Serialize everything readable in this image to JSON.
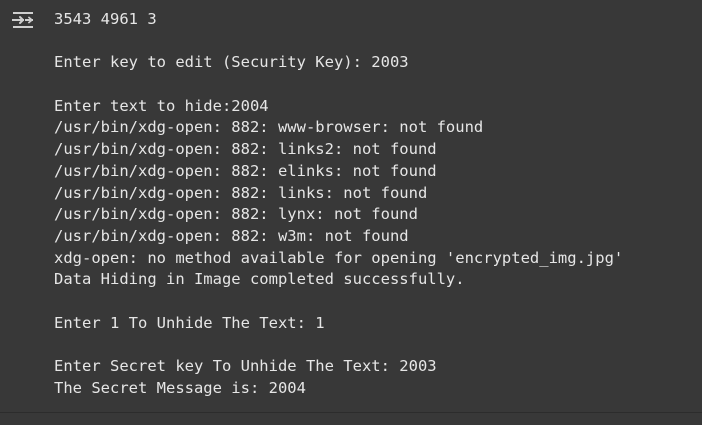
{
  "cell": {
    "toggle_icon": "output-toggle-icon",
    "lines": [
      "3543 4961 3",
      "",
      "Enter key to edit (Security Key): 2003",
      "",
      "Enter text to hide:2004",
      "/usr/bin/xdg-open: 882: www-browser: not found",
      "/usr/bin/xdg-open: 882: links2: not found",
      "/usr/bin/xdg-open: 882: elinks: not found",
      "/usr/bin/xdg-open: 882: links: not found",
      "/usr/bin/xdg-open: 882: lynx: not found",
      "/usr/bin/xdg-open: 882: w3m: not found",
      "xdg-open: no method available for opening 'encrypted_img.jpg'",
      "Data Hiding in Image completed successfully.",
      "",
      "Enter 1 To Unhide The Text: 1",
      "",
      "Enter Secret key To Unhide The Text: 2003",
      "The Secret Message is: 2004"
    ]
  },
  "colors": {
    "background": "#383838",
    "text": "#e6e6e6",
    "icon": "#d0d0d0"
  }
}
